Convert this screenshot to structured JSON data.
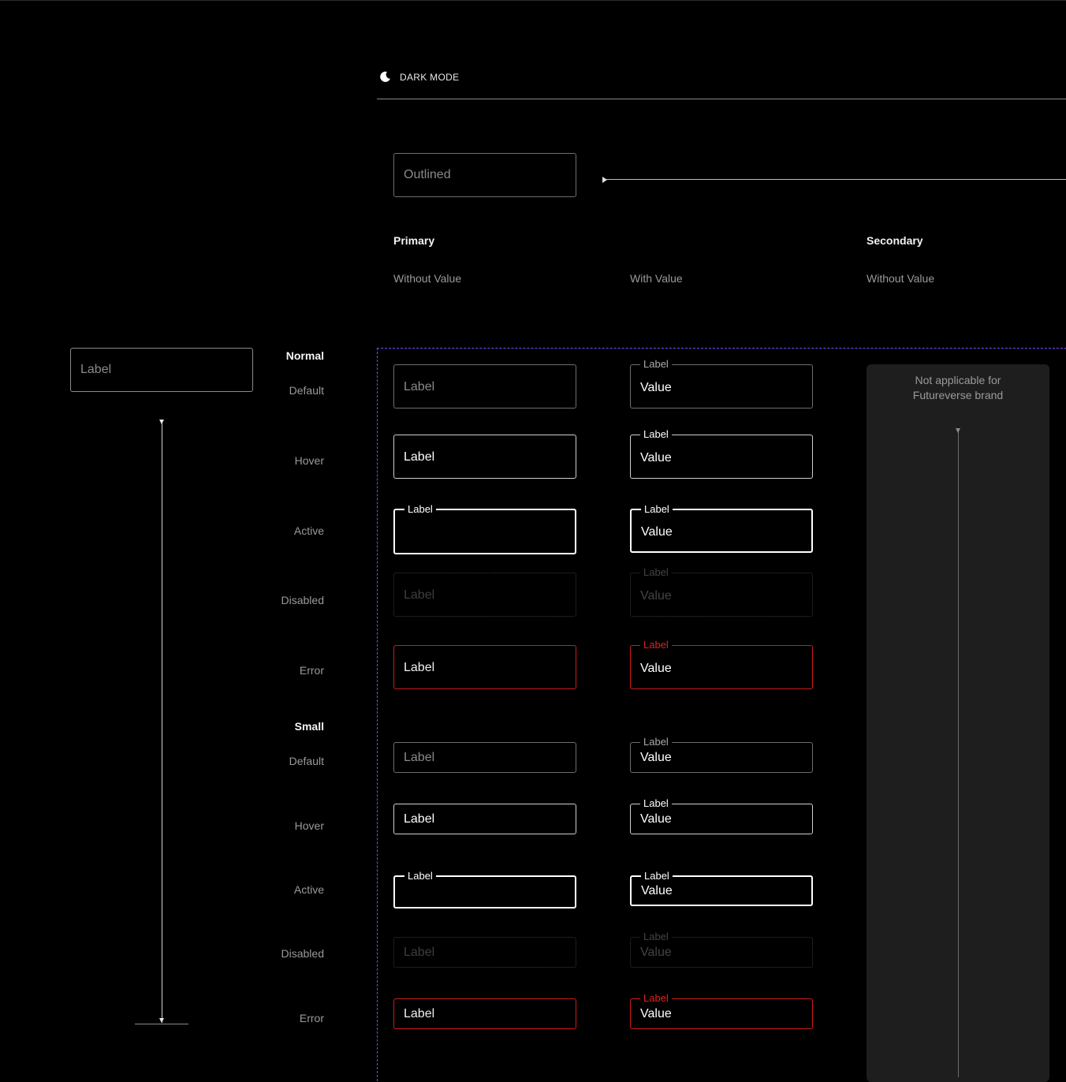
{
  "header": {
    "mode_label": "DARK MODE",
    "mode_icon": "moon-icon"
  },
  "sample": {
    "outlined_placeholder": "Outlined"
  },
  "left_sample": {
    "placeholder": "Label"
  },
  "groups": {
    "primary": "Primary",
    "secondary": "Secondary"
  },
  "columns": {
    "without_value": "Without Value",
    "with_value": "With Value",
    "secondary_without_value": "Without Value"
  },
  "sections": {
    "normal": {
      "title": "Normal",
      "rows": {
        "default": "Default",
        "hover": "Hover",
        "active": "Active",
        "disabled": "Disabled",
        "error": "Error"
      }
    },
    "small": {
      "title": "Small",
      "rows": {
        "default": "Default",
        "hover": "Hover",
        "active": "Active",
        "disabled": "Disabled",
        "error": "Error"
      }
    }
  },
  "field": {
    "label": "Label",
    "value": "Value"
  },
  "secondary_panel": {
    "line1": "Not applicable for",
    "line2": "Futureverse brand"
  },
  "colors": {
    "background": "#000000",
    "error": "#d11a1a",
    "frame_dash": "#7a4dff",
    "panel": "#1e1e1e"
  }
}
